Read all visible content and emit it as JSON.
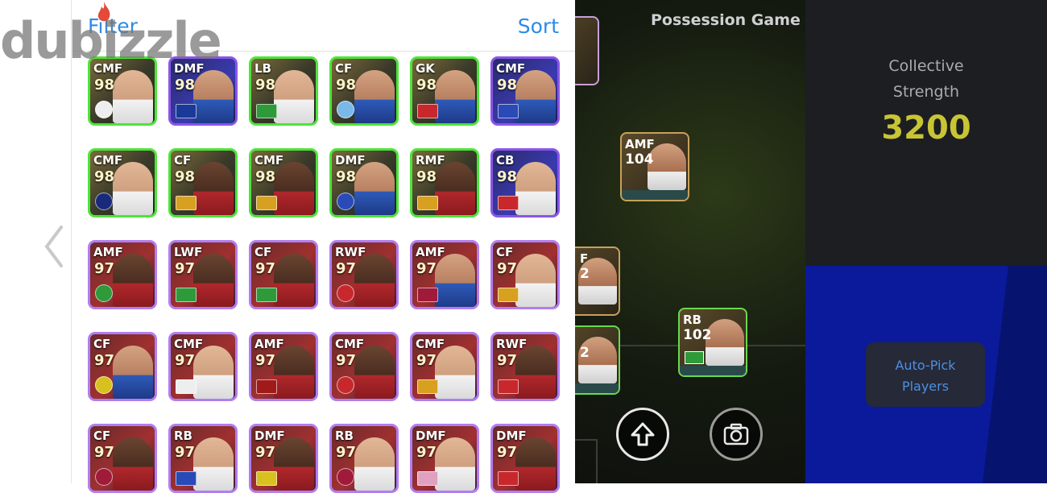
{
  "watermark": {
    "text": "dubizzle"
  },
  "panel": {
    "filter_label": "Filter",
    "sort_label": "Sort"
  },
  "cards": [
    {
      "pos": "CMF",
      "rating": "98",
      "tier": "green",
      "face": "light",
      "badge_color": "#eeeeee"
    },
    {
      "pos": "DMF",
      "rating": "98",
      "tier": "purple",
      "face": "blue",
      "badge_color": "#1a3a9a"
    },
    {
      "pos": "LB",
      "rating": "98",
      "tier": "green",
      "face": "light",
      "badge_color": "#2e9a3a"
    },
    {
      "pos": "CF",
      "rating": "98",
      "tier": "green",
      "face": "blue",
      "badge_color": "#7ab8ea"
    },
    {
      "pos": "GK",
      "rating": "98",
      "tier": "green",
      "face": "blue",
      "badge_color": "#c8282c"
    },
    {
      "pos": "CMF",
      "rating": "98",
      "tier": "purple",
      "face": "blue",
      "badge_color": "#2a4ab8"
    },
    {
      "pos": "CMF",
      "rating": "98",
      "tier": "green",
      "face": "light",
      "badge_color": "#1a2a7a"
    },
    {
      "pos": "CF",
      "rating": "98",
      "tier": "green",
      "face": "dark",
      "badge_color": "#d8a020"
    },
    {
      "pos": "CMF",
      "rating": "98",
      "tier": "green",
      "face": "dark",
      "badge_color": "#d8a020"
    },
    {
      "pos": "DMF",
      "rating": "98",
      "tier": "green",
      "face": "blue",
      "badge_color": "#2a4ab8"
    },
    {
      "pos": "RMF",
      "rating": "98",
      "tier": "green",
      "face": "dark",
      "badge_color": "#d8a020"
    },
    {
      "pos": "CB",
      "rating": "98",
      "tier": "purple",
      "face": "light",
      "badge_color": "#c8282c"
    },
    {
      "pos": "AMF",
      "rating": "97",
      "tier": "violet",
      "face": "dark",
      "badge_color": "#2e9a3a"
    },
    {
      "pos": "LWF",
      "rating": "97",
      "tier": "violet",
      "face": "dark",
      "badge_color": "#2e9a3a"
    },
    {
      "pos": "CF",
      "rating": "97",
      "tier": "violet",
      "face": "dark",
      "badge_color": "#2e9a3a"
    },
    {
      "pos": "RWF",
      "rating": "97",
      "tier": "violet",
      "face": "dark",
      "badge_color": "#c8282c"
    },
    {
      "pos": "AMF",
      "rating": "97",
      "tier": "violet",
      "face": "blue",
      "badge_color": "#a01a3a"
    },
    {
      "pos": "CF",
      "rating": "97",
      "tier": "violet",
      "face": "light",
      "badge_color": "#d8a020"
    },
    {
      "pos": "CF",
      "rating": "97",
      "tier": "violet",
      "face": "blue",
      "badge_color": "#d8c020"
    },
    {
      "pos": "CMF",
      "rating": "97",
      "tier": "violet",
      "face": "light",
      "badge_color": "#eeeeee"
    },
    {
      "pos": "AMF",
      "rating": "97",
      "tier": "violet",
      "face": "dark",
      "badge_color": "#a01a1a"
    },
    {
      "pos": "CMF",
      "rating": "97",
      "tier": "violet",
      "face": "dark",
      "badge_color": "#c8282c"
    },
    {
      "pos": "CMF",
      "rating": "97",
      "tier": "violet",
      "face": "light",
      "badge_color": "#d8a020"
    },
    {
      "pos": "RWF",
      "rating": "97",
      "tier": "violet",
      "face": "dark",
      "badge_color": "#c8282c"
    },
    {
      "pos": "CF",
      "rating": "97",
      "tier": "violet",
      "face": "dark",
      "badge_color": "#a01a3a"
    },
    {
      "pos": "RB",
      "rating": "97",
      "tier": "violet",
      "face": "light",
      "badge_color": "#2a4ab8"
    },
    {
      "pos": "DMF",
      "rating": "97",
      "tier": "violet",
      "face": "dark",
      "badge_color": "#d8c020"
    },
    {
      "pos": "RB",
      "rating": "97",
      "tier": "violet",
      "face": "light",
      "badge_color": "#a01a3a"
    },
    {
      "pos": "DMF",
      "rating": "97",
      "tier": "violet",
      "face": "light",
      "badge_color": "#e0a0c0"
    },
    {
      "pos": "DMF",
      "rating": "97",
      "tier": "violet",
      "face": "dark",
      "badge_color": "#c8282c"
    }
  ],
  "game": {
    "mode_title": "Possession Game",
    "collective_line1": "Collective",
    "collective_line2": "Strength",
    "collective_value": "3200",
    "autopick_line1": "Auto-Pick",
    "autopick_line2": "Players",
    "field_cards": [
      {
        "pos": "AMF",
        "rating": "104"
      },
      {
        "pos": "RB",
        "rating": "102"
      },
      {
        "pos": "F",
        "rating": "2"
      },
      {
        "pos": "",
        "rating": "2"
      }
    ]
  },
  "icons": {
    "back": "chevron-left-icon",
    "share": "upload-arrow-icon",
    "camera": "camera-icon"
  }
}
